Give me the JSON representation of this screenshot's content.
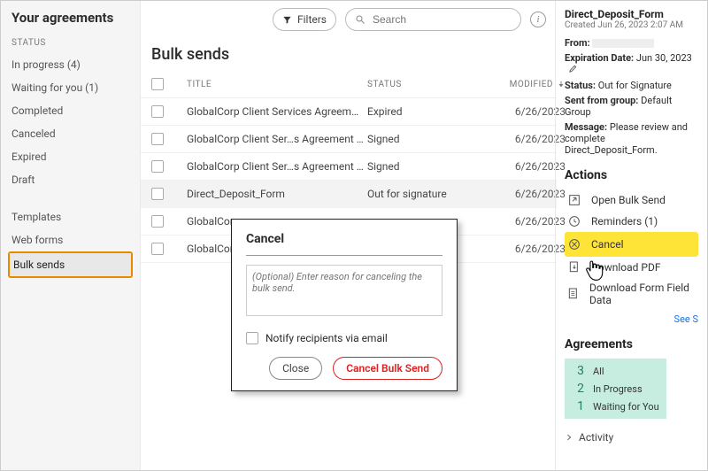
{
  "sidebar": {
    "title": "Your agreements",
    "section_label": "STATUS",
    "items": [
      {
        "label": "In progress (4)"
      },
      {
        "label": "Waiting for you (1)"
      },
      {
        "label": "Completed"
      },
      {
        "label": "Canceled"
      },
      {
        "label": "Expired"
      },
      {
        "label": "Draft"
      }
    ],
    "secondary": [
      {
        "label": "Templates"
      },
      {
        "label": "Web forms"
      },
      {
        "label": "Bulk sends",
        "selected": true
      }
    ]
  },
  "header": {
    "filters_label": "Filters",
    "search_placeholder": "Search"
  },
  "main": {
    "heading": "Bulk sends",
    "columns": {
      "title": "TITLE",
      "status": "STATUS",
      "modified": "MODIFIED"
    },
    "rows": [
      {
        "title": "GlobalCorp Client Services Agreement",
        "status": "Expired",
        "modified": "6/26/2023"
      },
      {
        "title": "GlobalCorp Client Ser…s Agreement with fields",
        "status": "Signed",
        "modified": "6/26/2023"
      },
      {
        "title": "GlobalCorp Client Ser…s Agreement with fields",
        "status": "Signed",
        "modified": "6/26/2023"
      },
      {
        "title": "Direct_Deposit_Form",
        "status": "Out for signature",
        "modified": "6/26/2023",
        "selected": true
      },
      {
        "title": "GlobalCor",
        "status": "",
        "modified": "6/26/2023"
      },
      {
        "title": "GlobalCor",
        "status": "",
        "modified": "6/26/2023"
      }
    ]
  },
  "details": {
    "title": "Direct_Deposit_Form",
    "created": "Created Jun 26, 2023 2:07 AM",
    "from_label": "From:",
    "expiration_label": "Expiration Date:",
    "expiration_value": "Jun 30, 2023",
    "status_label": "Status:",
    "status_value": "Out for Signature",
    "group_label": "Sent from group:",
    "group_value": "Default Group",
    "message_label": "Message:",
    "message_value": "Please review and complete Direct_Deposit_Form."
  },
  "actions": {
    "heading": "Actions",
    "open": "Open Bulk Send",
    "reminders": "Reminders (1)",
    "cancel": "Cancel",
    "download_pdf": "Download PDF",
    "download_fields": "Download Form Field Data",
    "see_all": "See S"
  },
  "agreements": {
    "heading": "Agreements",
    "items": [
      {
        "n": "3",
        "t": "All"
      },
      {
        "n": "2",
        "t": "In Progress"
      },
      {
        "n": "1",
        "t": "Waiting for You"
      }
    ]
  },
  "activity_label": "Activity",
  "dialog": {
    "title": "Cancel",
    "placeholder": "(Optional) Enter reason for canceling the bulk send.",
    "notify": "Notify recipients via email",
    "close": "Close",
    "confirm": "Cancel Bulk Send"
  }
}
